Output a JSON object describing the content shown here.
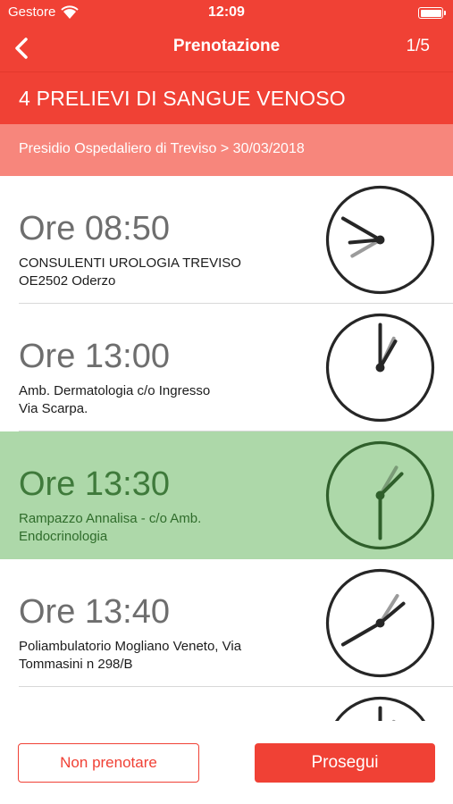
{
  "status": {
    "carrier": "Gestore",
    "time": "12:09",
    "wifi_icon": "wifi-icon",
    "battery_icon": "battery-icon"
  },
  "nav": {
    "title": "Prenotazione",
    "page": "1/5",
    "back_icon": "chevron-left-icon"
  },
  "header": {
    "title": "4 PRELIEVI DI SANGUE VENOSO"
  },
  "subheader": {
    "text": "Presidio Ospedaliero di Treviso > 30/03/2018"
  },
  "slots": [
    {
      "time": "Ore 08:50",
      "line1": "CONSULENTI UROLOGIA TREVISO",
      "line2": "OE2502 Oderzo",
      "selected": false,
      "hour": 8,
      "minute": 50
    },
    {
      "time": "Ore 13:00",
      "line1": "Amb. Dermatologia c/o Ingresso",
      "line2": "Via Scarpa.",
      "selected": false,
      "hour": 13,
      "minute": 0
    },
    {
      "time": "Ore 13:30",
      "line1": "Rampazzo Annalisa - c/o Amb.",
      "line2": "Endocrinologia",
      "selected": true,
      "hour": 13,
      "minute": 30
    },
    {
      "time": "Ore 13:40",
      "line1": "Poliambulatorio Mogliano Veneto, Via",
      "line2": "Tommasini n 298/B",
      "selected": false,
      "hour": 13,
      "minute": 40
    },
    {
      "time": "",
      "line1": "",
      "line2": "",
      "selected": false,
      "hour": 12,
      "minute": 0
    }
  ],
  "buttons": {
    "decline": "Non prenotare",
    "continue": "Prosegui"
  },
  "colors": {
    "accent": "#f04135",
    "subheader": "#f7867c",
    "selected_bg": "#add8a9",
    "selected_text": "#3f7a3b"
  }
}
